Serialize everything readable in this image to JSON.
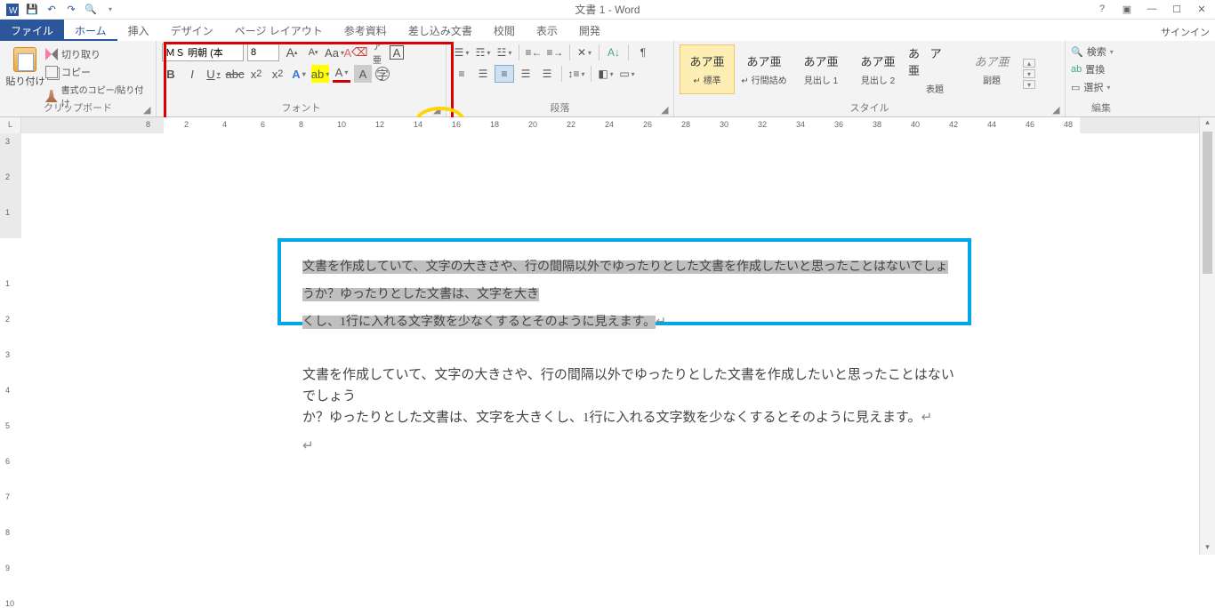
{
  "title": "文書 1 - Word",
  "signin": "サインイン",
  "tabs": {
    "file": "ファイル",
    "home": "ホーム",
    "insert": "挿入",
    "design": "デザイン",
    "layout": "ページ レイアウト",
    "references": "参考資料",
    "mailings": "差し込み文書",
    "review": "校閲",
    "view": "表示",
    "developer": "開発"
  },
  "clipboard": {
    "paste": "貼り付け",
    "cut": "切り取り",
    "copy": "コピー",
    "formatpainter": "書式のコピー/貼り付け",
    "label": "クリップボード"
  },
  "font": {
    "name": "ＭＳ 明朝 (本",
    "size": "8",
    "label": "フォント"
  },
  "paragraph": {
    "label": "段落"
  },
  "styles": {
    "label": "スタイル",
    "preview": "あア亜",
    "preview_wide": "あ ア 亜",
    "items": [
      "↵ 標準",
      "↵ 行間詰め",
      "見出し 1",
      "見出し 2",
      "表題",
      "副題"
    ]
  },
  "editing": {
    "find": "検索",
    "replace": "置換",
    "select": "選択",
    "label": "編集"
  },
  "ruler_h": [
    "8",
    "2",
    "4",
    "6",
    "8",
    "10",
    "12",
    "14",
    "16",
    "18",
    "20",
    "22",
    "24",
    "26",
    "28",
    "30",
    "32",
    "34",
    "36",
    "38",
    "40",
    "42",
    "44",
    "46",
    "48"
  ],
  "ruler_v": [
    "3",
    "2",
    "1",
    "",
    "1",
    "2",
    "3",
    "4",
    "5",
    "6",
    "7",
    "8",
    "9",
    "10"
  ],
  "doc": {
    "selected_line1": "文書を作成していて、文字の大きさや、行の間隔以外でゆったりとした文書を作成したいと思ったことはないでしょうか？ゆったりとした文書は、文字を大き",
    "selected_line2": "くし、1行に入れる文字数を少なくするとそのように見えます。",
    "plain_line1": "文書を作成していて、文字の大きさや、行の間隔以外でゆったりとした文書を作成したいと思ったことはないでしょう",
    "plain_line2": "か？ゆったりとした文書は、文字を大きくし、1行に入れる文字数を少なくするとそのように見えます。"
  }
}
